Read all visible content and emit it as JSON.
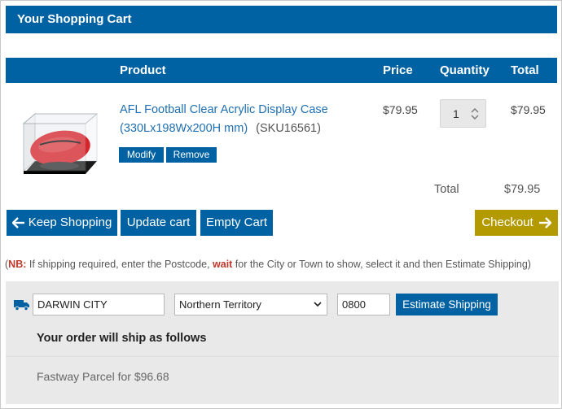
{
  "cart": {
    "title": "Your Shopping Cart"
  },
  "table": {
    "headers": {
      "product": "Product",
      "price": "Price",
      "quantity": "Quantity",
      "total": "Total"
    },
    "item": {
      "name": "AFL Football Clear Acrylic Display Case (330Lx198Wx200H mm)",
      "sku": "(SKU16561)",
      "price": "$79.95",
      "quantity": "1",
      "total": "$79.95",
      "modify_label": "Modify",
      "remove_label": "Remove"
    }
  },
  "summary": {
    "total_label": "Total",
    "total_value": "$79.95"
  },
  "actions": {
    "keep_shopping": "Keep Shopping",
    "update_cart": "Update cart",
    "empty_cart": "Empty Cart",
    "checkout": "Checkout"
  },
  "note": {
    "nb": "NB:",
    "part1": " If shipping required, enter the Postcode, ",
    "wait": "wait",
    "part2": " for the City or Town to show, select it and then Estimate Shipping)"
  },
  "shipping": {
    "city": "DARWIN CITY",
    "state": "Northern Territory",
    "postcode": "0800",
    "estimate_label": "Estimate Shipping",
    "heading": "Your order will ship as follows",
    "option": "Fastway Parcel for $96.68"
  },
  "colors": {
    "primary": "#0062a3",
    "checkout": "#b39a00",
    "link": "#1f6fb2",
    "nb_red": "#c0392b"
  },
  "icons": {
    "keep_shopping": "arrow-left-icon",
    "checkout": "arrow-right-icon",
    "quantity": "spinner-icon",
    "shipping": "truck-icon",
    "state": "chevron-down-icon"
  }
}
